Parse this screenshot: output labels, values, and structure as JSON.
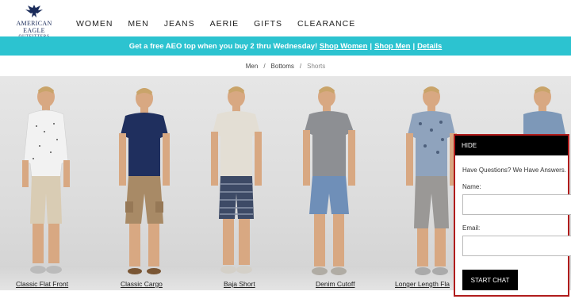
{
  "header": {
    "logo": {
      "line1": "AMERICAN EAGLE",
      "line2": "OUTFITTERS",
      "icon": "eagle-icon"
    },
    "nav": [
      "WOMEN",
      "MEN",
      "JEANS",
      "AERIE",
      "GIFTS",
      "CLEARANCE"
    ]
  },
  "promo": {
    "text": "Get a free AEO top when you buy 2 thru Wednesday!",
    "shop_women": "Shop Women",
    "divider": "|",
    "shop_men": "Shop Men",
    "details": "Details",
    "color": "#2cc3d0"
  },
  "breadcrumb": {
    "items": [
      "Men",
      "Bottoms",
      "Shorts"
    ],
    "separator": "/"
  },
  "hero": {
    "styles": [
      "Classic Flat Front",
      "Classic Cargo",
      "Baja Short",
      "Denim Cutoff",
      "Longer Length Fla",
      ""
    ]
  },
  "chat": {
    "hide": "HIDE",
    "question": "Have Questions? We Have Answers.",
    "name_label": "Name:",
    "email_label": "Email:",
    "button": "START CHAT",
    "border_color": "#b01c1c"
  }
}
